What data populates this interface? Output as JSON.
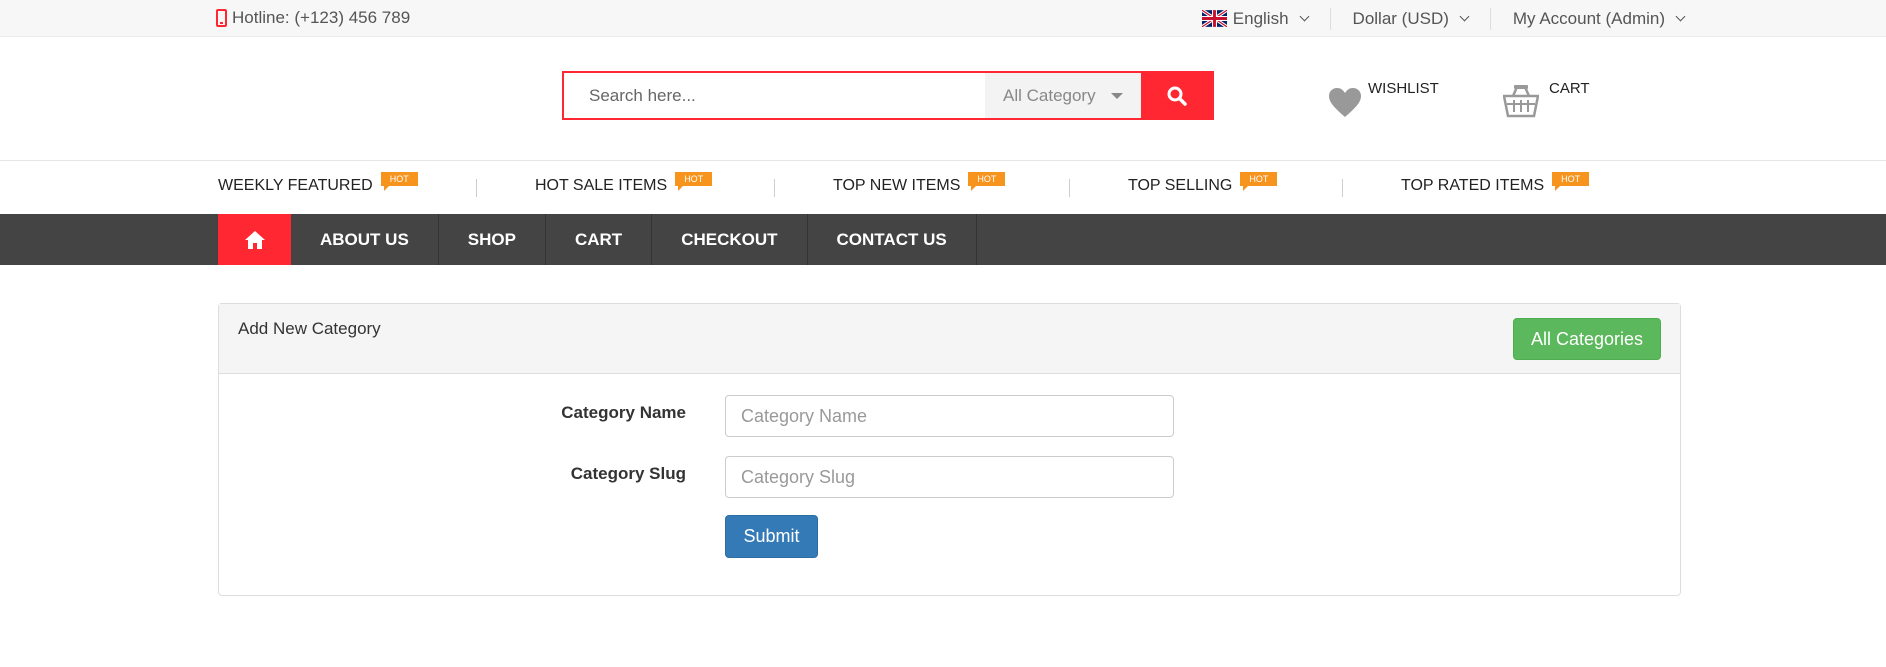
{
  "topbar": {
    "hotline": "Hotline: (+123) 456 789",
    "language": "English",
    "currency": "Dollar (USD)",
    "account": "My Account (Admin)"
  },
  "header": {
    "search_placeholder": "Search here...",
    "search_category": "All Category",
    "wishlist_label": "WISHLIST",
    "cart_label": "CART"
  },
  "category_strip": {
    "items": [
      {
        "label": "WEEKLY FEATURED",
        "badge": "HOT"
      },
      {
        "label": "HOT SALE ITEMS",
        "badge": "HOT"
      },
      {
        "label": "TOP NEW ITEMS",
        "badge": "HOT"
      },
      {
        "label": "TOP SELLING",
        "badge": "HOT"
      },
      {
        "label": "TOP RATED ITEMS",
        "badge": "HOT"
      }
    ]
  },
  "nav": {
    "home_icon": "home-icon",
    "links": [
      "ABOUT US",
      "SHOP",
      "CART",
      "CHECKOUT",
      "CONTACT US"
    ]
  },
  "panel": {
    "title": "Add New Category",
    "all_categories_button": "All Categories",
    "fields": [
      {
        "label": "Category Name",
        "placeholder": "Category Name",
        "value": ""
      },
      {
        "label": "Category Slug",
        "placeholder": "Category Slug",
        "value": ""
      }
    ],
    "submit_label": "Submit"
  },
  "colors": {
    "accent_red": "#ff2832",
    "nav_bg": "#444444",
    "hot_badge": "#f7941d",
    "success_green": "#5cb85c",
    "primary_blue": "#337ab7"
  }
}
